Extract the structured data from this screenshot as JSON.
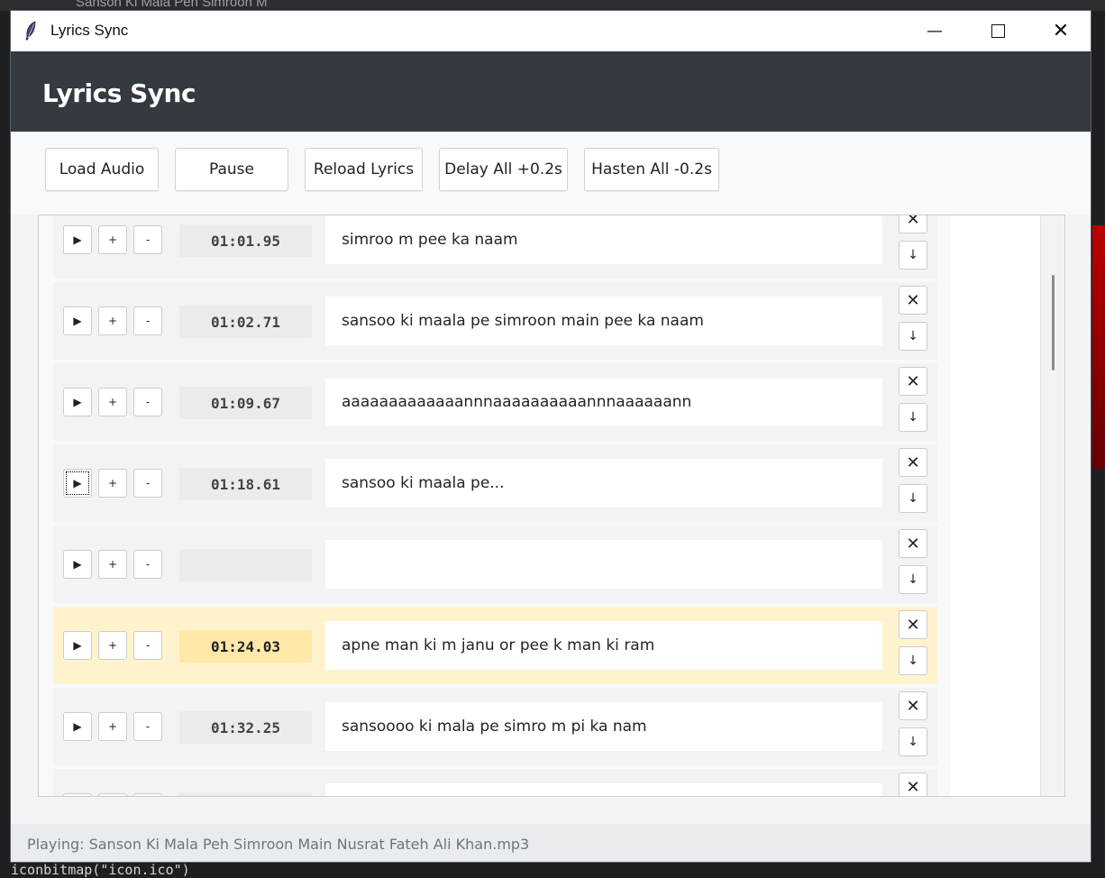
{
  "background": {
    "tab_title": "Sanson Ki Mala Peh Simroon M",
    "code_fragment": "iconbitmap(\"icon.ico\")"
  },
  "window": {
    "title": "Lyrics Sync",
    "minimize_glyph": "—",
    "close_glyph": "✕"
  },
  "header": {
    "title": "Lyrics Sync"
  },
  "toolbar": {
    "buttons": [
      {
        "label": "Load Audio"
      },
      {
        "label": "Pause"
      },
      {
        "label": "Reload Lyrics"
      },
      {
        "label": "Delay All +0.2s"
      },
      {
        "label": "Hasten All -0.2s"
      }
    ]
  },
  "row_controls": {
    "play": "▶",
    "plus": "+",
    "minus": "-",
    "delete": "✕",
    "move_down": "↓"
  },
  "lyrics": [
    {
      "time": "01:01.95",
      "text": "simroo m pee ka naam",
      "active": false
    },
    {
      "time": "01:02.71",
      "text": "sansoo ki maala pe simroon main pee ka naam",
      "active": false
    },
    {
      "time": "01:09.67",
      "text": "aaaaaaaaaaaaannnaaaaaaaaaannnaaaaaann",
      "active": false
    },
    {
      "time": "01:18.61",
      "text": "sansoo ki maala pe...",
      "active": false
    },
    {
      "time": "",
      "text": "",
      "active": false
    },
    {
      "time": "01:24.03",
      "text": "apne man ki m janu or pee k man ki ram",
      "active": true
    },
    {
      "time": "01:32.25",
      "text": "sansoooo ki mala pe simro m pi ka nam",
      "active": false
    },
    {
      "time": "",
      "text": "",
      "active": false
    }
  ],
  "status": {
    "text": "Playing: Sanson Ki Mala Peh Simroon Main Nusrat Fateh Ali Khan.mp3"
  },
  "colors": {
    "header_bg": "#343a40",
    "active_row_bg": "#fff3cd",
    "active_time_bg": "#ffe8a8"
  }
}
